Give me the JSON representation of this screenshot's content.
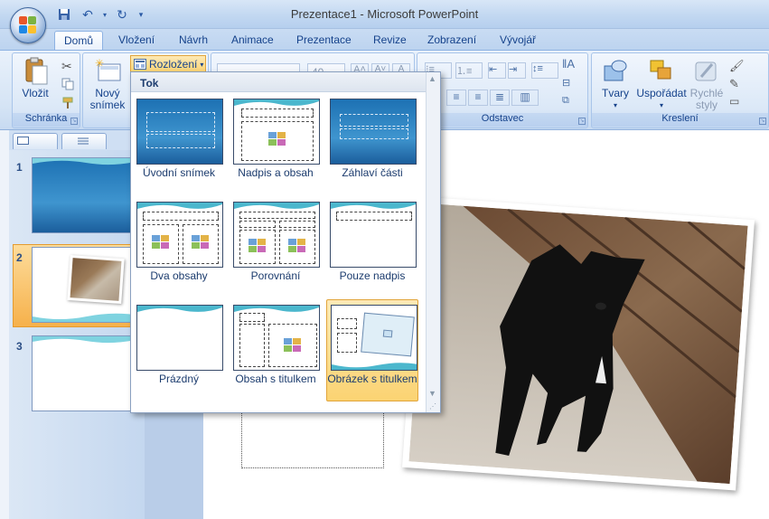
{
  "window": {
    "title": "Prezentace1 - Microsoft PowerPoint"
  },
  "tabs": [
    {
      "label": "Domů",
      "active": true
    },
    {
      "label": "Vložení"
    },
    {
      "label": "Návrh"
    },
    {
      "label": "Animace"
    },
    {
      "label": "Prezentace"
    },
    {
      "label": "Revize"
    },
    {
      "label": "Zobrazení"
    },
    {
      "label": "Vývojář"
    }
  ],
  "ribbon": {
    "clipboard": {
      "label": "Schránka",
      "paste": "Vložit"
    },
    "slides": {
      "new_slide_1": "Nový",
      "new_slide_2": "snímek",
      "layout": "Rozložení"
    },
    "font": {
      "size": "40"
    },
    "paragraph": {
      "label": "Odstavec"
    },
    "drawing": {
      "label": "Kreslení",
      "shapes": "Tvary",
      "arrange": "Uspořádat",
      "quick_styles_1": "Rychlé",
      "quick_styles_2": "styly"
    }
  },
  "gallery": {
    "heading": "Tok",
    "layouts": [
      {
        "label": "Úvodní snímek"
      },
      {
        "label": "Nadpis a obsah"
      },
      {
        "label": "Záhlaví části"
      },
      {
        "label": "Dva obsahy"
      },
      {
        "label": "Porovnání"
      },
      {
        "label": "Pouze nadpis"
      },
      {
        "label": "Prázdný"
      },
      {
        "label": "Obsah s titulkem"
      },
      {
        "label": "Obrázek s titulkem",
        "highlighted": true
      }
    ]
  },
  "slides": [
    {
      "number": "1"
    },
    {
      "number": "2",
      "selected": true
    },
    {
      "number": "3"
    }
  ],
  "colors": {
    "accent": "#f6b14b",
    "ribbon": "#dbe8f7",
    "theme_blue": "#1d71b3"
  }
}
